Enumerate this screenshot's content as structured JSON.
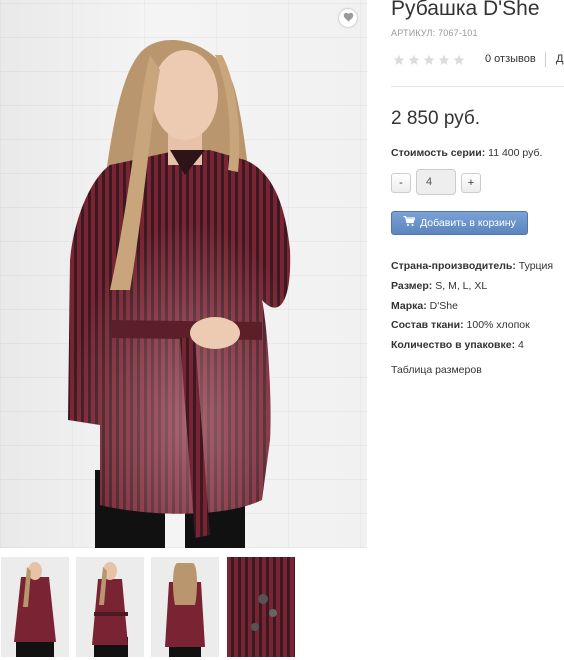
{
  "product": {
    "title": "Рубашка D'She",
    "sku_label": "АРТИКУЛ:",
    "sku_value": "7067-101",
    "rating_stars": 0,
    "reviews": "0 отзывов",
    "truncated_link": "Д",
    "price": "2 850 руб.",
    "series_label": "Стоимость серии:",
    "series_value": "11 400 руб.",
    "quantity": "4",
    "minus_label": "-",
    "plus_label": "+",
    "add_to_cart": "Добавить в корзину",
    "attributes": [
      {
        "label": "Страна-производитель:",
        "value": "Турция"
      },
      {
        "label": "Размер:",
        "value": "S, M, L, XL"
      },
      {
        "label": "Марка:",
        "value": "D'She"
      },
      {
        "label": "Состав ткани:",
        "value": "100% хлопок"
      },
      {
        "label": "Количество в упаковке:",
        "value": "4"
      }
    ],
    "size_table_link": "Таблица размеров"
  },
  "icons": {
    "favorite": "heart-icon",
    "cart": "cart-icon",
    "star": "star-icon"
  },
  "colors": {
    "button_blue": "#6891c9",
    "shirt": "#6b2230",
    "star": "#dcdcdc"
  }
}
